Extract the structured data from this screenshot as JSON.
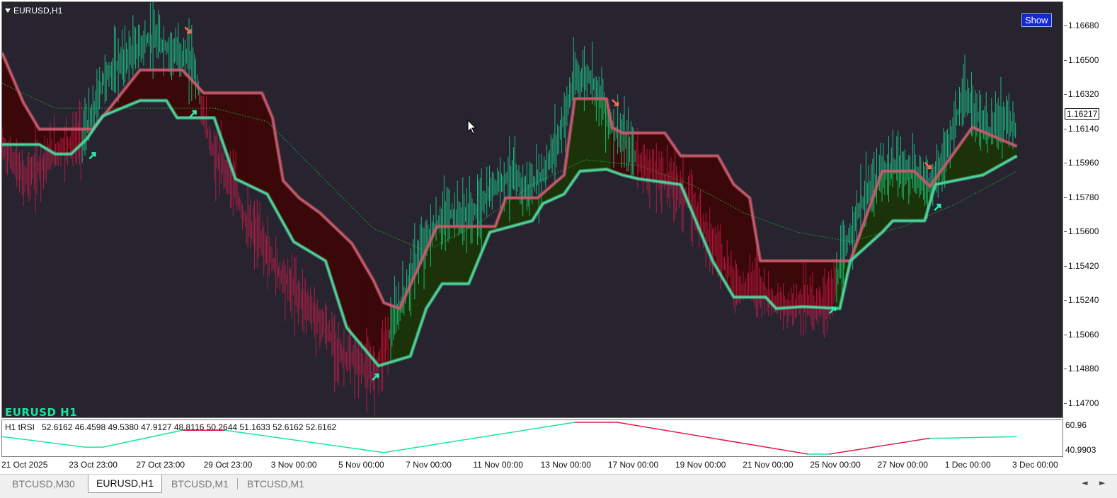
{
  "symbol": "EURUSD,H1",
  "show_button": "Show",
  "chart_label": "EURUSD H1",
  "current_price": "1.16217",
  "price_axis": [
    "1.16680",
    "1.16500",
    "1.16320",
    "1.16140",
    "1.15960",
    "1.15780",
    "1.15600",
    "1.15420",
    "1.15240",
    "1.15060",
    "1.14880",
    "1.14700"
  ],
  "indicator": {
    "label": "H1 tRSI",
    "values": "52.6162 46.4598 49.5380 47.9127 48.8116 50.2644 51.1633 52.6162 52.6162",
    "axis_top": "60.96",
    "axis_bottom": "40.9903"
  },
  "time_axis": [
    "21 Oct 2025",
    "23 Oct 23:00",
    "27 Oct 23:00",
    "29 Oct 23:00",
    "3 Nov 00:00",
    "5 Nov 00:00",
    "7 Nov 00:00",
    "11 Nov 00:00",
    "13 Nov 00:00",
    "17 Nov 00:00",
    "19 Nov 00:00",
    "21 Nov 00:00",
    "25 Nov 00:00",
    "27 Nov 00:00",
    "1 Dec 00:00",
    "3 Dec 00:00"
  ],
  "tabs": [
    "BTCUSD,M30",
    "EURUSD,H1",
    "BTCUSD,M1",
    "BTCUSD,M1"
  ],
  "active_tab": 1,
  "nav_left": "◄",
  "nav_right": "►",
  "colors": {
    "background": "#27242f",
    "bull": "#19e69a",
    "bear": "#d81c4c",
    "bull_fill": "#1c3309",
    "bear_fill": "#3a0808",
    "ma": "#1f9a3a"
  },
  "chart_data": {
    "type": "line",
    "y_range": [
      1.1462,
      1.1689
    ],
    "price": [
      {
        "t": 0,
        "p": 1.1605
      },
      {
        "t": 0.01,
        "p": 1.1598
      },
      {
        "t": 0.02,
        "p": 1.1588
      },
      {
        "t": 0.03,
        "p": 1.1592
      },
      {
        "t": 0.045,
        "p": 1.16
      },
      {
        "t": 0.06,
        "p": 1.1606
      },
      {
        "t": 0.075,
        "p": 1.161
      },
      {
        "t": 0.085,
        "p": 1.162
      },
      {
        "t": 0.095,
        "p": 1.164
      },
      {
        "t": 0.11,
        "p": 1.1648
      },
      {
        "t": 0.125,
        "p": 1.1655
      },
      {
        "t": 0.14,
        "p": 1.1662
      },
      {
        "t": 0.16,
        "p": 1.1655
      },
      {
        "t": 0.18,
        "p": 1.165
      },
      {
        "t": 0.19,
        "p": 1.162
      },
      {
        "t": 0.2,
        "p": 1.16
      },
      {
        "t": 0.215,
        "p": 1.159
      },
      {
        "t": 0.23,
        "p": 1.1565
      },
      {
        "t": 0.245,
        "p": 1.1555
      },
      {
        "t": 0.26,
        "p": 1.154
      },
      {
        "t": 0.275,
        "p": 1.153
      },
      {
        "t": 0.29,
        "p": 1.152
      },
      {
        "t": 0.305,
        "p": 1.151
      },
      {
        "t": 0.32,
        "p": 1.1495
      },
      {
        "t": 0.335,
        "p": 1.1492
      },
      {
        "t": 0.35,
        "p": 1.1485
      },
      {
        "t": 0.36,
        "p": 1.15
      },
      {
        "t": 0.375,
        "p": 1.152
      },
      {
        "t": 0.39,
        "p": 1.1545
      },
      {
        "t": 0.405,
        "p": 1.156
      },
      {
        "t": 0.42,
        "p": 1.157
      },
      {
        "t": 0.435,
        "p": 1.1568
      },
      {
        "t": 0.45,
        "p": 1.1572
      },
      {
        "t": 0.465,
        "p": 1.1585
      },
      {
        "t": 0.48,
        "p": 1.159
      },
      {
        "t": 0.495,
        "p": 1.1582
      },
      {
        "t": 0.51,
        "p": 1.159
      },
      {
        "t": 0.525,
        "p": 1.161
      },
      {
        "t": 0.54,
        "p": 1.164
      },
      {
        "t": 0.555,
        "p": 1.1642
      },
      {
        "t": 0.565,
        "p": 1.163
      },
      {
        "t": 0.575,
        "p": 1.1615
      },
      {
        "t": 0.59,
        "p": 1.1605
      },
      {
        "t": 0.605,
        "p": 1.1595
      },
      {
        "t": 0.62,
        "p": 1.159
      },
      {
        "t": 0.635,
        "p": 1.1585
      },
      {
        "t": 0.65,
        "p": 1.1575
      },
      {
        "t": 0.665,
        "p": 1.156
      },
      {
        "t": 0.68,
        "p": 1.1545
      },
      {
        "t": 0.695,
        "p": 1.153
      },
      {
        "t": 0.71,
        "p": 1.1535
      },
      {
        "t": 0.725,
        "p": 1.1525
      },
      {
        "t": 0.74,
        "p": 1.152
      },
      {
        "t": 0.755,
        "p": 1.1525
      },
      {
        "t": 0.77,
        "p": 1.152
      },
      {
        "t": 0.785,
        "p": 1.153
      },
      {
        "t": 0.8,
        "p": 1.156
      },
      {
        "t": 0.815,
        "p": 1.158
      },
      {
        "t": 0.83,
        "p": 1.159
      },
      {
        "t": 0.845,
        "p": 1.1595
      },
      {
        "t": 0.86,
        "p": 1.159
      },
      {
        "t": 0.875,
        "p": 1.1585
      },
      {
        "t": 0.89,
        "p": 1.16
      },
      {
        "t": 0.905,
        "p": 1.163
      },
      {
        "t": 0.915,
        "p": 1.1625
      },
      {
        "t": 0.93,
        "p": 1.1612
      },
      {
        "t": 0.945,
        "p": 1.162
      },
      {
        "t": 0.955,
        "p": 1.1615
      }
    ],
    "upper_band": [
      {
        "t": 0,
        "p": 1.1654
      },
      {
        "t": 0.02,
        "p": 1.1628
      },
      {
        "t": 0.035,
        "p": 1.1614
      },
      {
        "t": 0.085,
        "p": 1.1614
      },
      {
        "t": 0.1,
        "p": 1.1624
      },
      {
        "t": 0.13,
        "p": 1.1645
      },
      {
        "t": 0.17,
        "p": 1.1645
      },
      {
        "t": 0.19,
        "p": 1.1633
      },
      {
        "t": 0.245,
        "p": 1.1633
      },
      {
        "t": 0.255,
        "p": 1.162
      },
      {
        "t": 0.265,
        "p": 1.1587
      },
      {
        "t": 0.28,
        "p": 1.1578
      },
      {
        "t": 0.3,
        "p": 1.157
      },
      {
        "t": 0.33,
        "p": 1.1554
      },
      {
        "t": 0.35,
        "p": 1.1535
      },
      {
        "t": 0.36,
        "p": 1.1523
      },
      {
        "t": 0.375,
        "p": 1.152
      },
      {
        "t": 0.41,
        "p": 1.1563
      },
      {
        "t": 0.465,
        "p": 1.1563
      },
      {
        "t": 0.475,
        "p": 1.1578
      },
      {
        "t": 0.505,
        "p": 1.1578
      },
      {
        "t": 0.53,
        "p": 1.159
      },
      {
        "t": 0.54,
        "p": 1.163
      },
      {
        "t": 0.57,
        "p": 1.163
      },
      {
        "t": 0.575,
        "p": 1.1615
      },
      {
        "t": 0.585,
        "p": 1.1612
      },
      {
        "t": 0.625,
        "p": 1.1612
      },
      {
        "t": 0.64,
        "p": 1.16
      },
      {
        "t": 0.675,
        "p": 1.16
      },
      {
        "t": 0.69,
        "p": 1.1585
      },
      {
        "t": 0.705,
        "p": 1.1578
      },
      {
        "t": 0.715,
        "p": 1.1545
      },
      {
        "t": 0.78,
        "p": 1.1545
      },
      {
        "t": 0.79,
        "p": 1.1545
      },
      {
        "t": 0.8,
        "p": 1.1545
      },
      {
        "t": 0.83,
        "p": 1.1592
      },
      {
        "t": 0.86,
        "p": 1.1592
      },
      {
        "t": 0.875,
        "p": 1.1584
      },
      {
        "t": 0.915,
        "p": 1.1615
      },
      {
        "t": 0.957,
        "p": 1.1605
      }
    ],
    "lower_band": [
      {
        "t": 0,
        "p": 1.1606
      },
      {
        "t": 0.035,
        "p": 1.1606
      },
      {
        "t": 0.05,
        "p": 1.1601
      },
      {
        "t": 0.065,
        "p": 1.1601
      },
      {
        "t": 0.08,
        "p": 1.1609
      },
      {
        "t": 0.095,
        "p": 1.1621
      },
      {
        "t": 0.13,
        "p": 1.1629
      },
      {
        "t": 0.155,
        "p": 1.1629
      },
      {
        "t": 0.165,
        "p": 1.162
      },
      {
        "t": 0.2,
        "p": 1.162
      },
      {
        "t": 0.22,
        "p": 1.1588
      },
      {
        "t": 0.25,
        "p": 1.158
      },
      {
        "t": 0.275,
        "p": 1.1555
      },
      {
        "t": 0.305,
        "p": 1.1545
      },
      {
        "t": 0.325,
        "p": 1.151
      },
      {
        "t": 0.355,
        "p": 1.149
      },
      {
        "t": 0.385,
        "p": 1.1495
      },
      {
        "t": 0.4,
        "p": 1.152
      },
      {
        "t": 0.415,
        "p": 1.1533
      },
      {
        "t": 0.44,
        "p": 1.1533
      },
      {
        "t": 0.46,
        "p": 1.156
      },
      {
        "t": 0.5,
        "p": 1.1566
      },
      {
        "t": 0.51,
        "p": 1.1575
      },
      {
        "t": 0.53,
        "p": 1.158
      },
      {
        "t": 0.545,
        "p": 1.1592
      },
      {
        "t": 0.57,
        "p": 1.1593
      },
      {
        "t": 0.585,
        "p": 1.159
      },
      {
        "t": 0.6,
        "p": 1.1588
      },
      {
        "t": 0.64,
        "p": 1.1585
      },
      {
        "t": 0.67,
        "p": 1.1545
      },
      {
        "t": 0.69,
        "p": 1.1526
      },
      {
        "t": 0.72,
        "p": 1.1526
      },
      {
        "t": 0.73,
        "p": 1.152
      },
      {
        "t": 0.755,
        "p": 1.1521
      },
      {
        "t": 0.79,
        "p": 1.152
      },
      {
        "t": 0.8,
        "p": 1.1545
      },
      {
        "t": 0.83,
        "p": 1.156
      },
      {
        "t": 0.84,
        "p": 1.1566
      },
      {
        "t": 0.87,
        "p": 1.1566
      },
      {
        "t": 0.88,
        "p": 1.1585
      },
      {
        "t": 0.925,
        "p": 1.159
      },
      {
        "t": 0.957,
        "p": 1.16
      }
    ],
    "moving_average": [
      {
        "t": 0,
        "p": 1.1638
      },
      {
        "t": 0.05,
        "p": 1.1625
      },
      {
        "t": 0.1,
        "p": 1.1625
      },
      {
        "t": 0.15,
        "p": 1.1625
      },
      {
        "t": 0.2,
        "p": 1.1625
      },
      {
        "t": 0.25,
        "p": 1.1618
      },
      {
        "t": 0.3,
        "p": 1.159
      },
      {
        "t": 0.35,
        "p": 1.1562
      },
      {
        "t": 0.4,
        "p": 1.155
      },
      {
        "t": 0.45,
        "p": 1.1565
      },
      {
        "t": 0.5,
        "p": 1.1585
      },
      {
        "t": 0.55,
        "p": 1.1598
      },
      {
        "t": 0.6,
        "p": 1.1595
      },
      {
        "t": 0.65,
        "p": 1.1585
      },
      {
        "t": 0.7,
        "p": 1.157
      },
      {
        "t": 0.75,
        "p": 1.156
      },
      {
        "t": 0.8,
        "p": 1.1555
      },
      {
        "t": 0.85,
        "p": 1.1563
      },
      {
        "t": 0.9,
        "p": 1.1575
      },
      {
        "t": 0.957,
        "p": 1.1592
      }
    ],
    "signals": [
      {
        "t": 0.085,
        "p": 1.16,
        "dir": "up"
      },
      {
        "t": 0.175,
        "p": 1.1666,
        "dir": "down"
      },
      {
        "t": 0.18,
        "p": 1.1622,
        "dir": "up"
      },
      {
        "t": 0.352,
        "p": 1.1484,
        "dir": "up"
      },
      {
        "t": 0.578,
        "p": 1.1628,
        "dir": "down"
      },
      {
        "t": 0.783,
        "p": 1.1519,
        "dir": "up"
      },
      {
        "t": 0.873,
        "p": 1.1595,
        "dir": "down"
      },
      {
        "t": 0.882,
        "p": 1.1573,
        "dir": "up"
      }
    ],
    "oscillator": [
      {
        "t": 0,
        "v": 0.45,
        "c": "bear"
      },
      {
        "t": 0.078,
        "v": 0.78,
        "c": "bull"
      },
      {
        "t": 0.095,
        "v": 0.78,
        "c": "bull"
      },
      {
        "t": 0.17,
        "v": 0.25,
        "c": "bull"
      },
      {
        "t": 0.21,
        "v": 0.25,
        "c": "bear"
      },
      {
        "t": 0.36,
        "v": 0.95,
        "c": "bull"
      },
      {
        "t": 0.54,
        "v": 0.0,
        "c": "bull"
      },
      {
        "t": 0.58,
        "v": 0.0,
        "c": "bear"
      },
      {
        "t": 0.76,
        "v": 1.0,
        "c": "bear"
      },
      {
        "t": 0.78,
        "v": 1.0,
        "c": "bull"
      },
      {
        "t": 0.875,
        "v": 0.5,
        "c": "bear"
      },
      {
        "t": 0.885,
        "v": 0.5,
        "c": "bull"
      },
      {
        "t": 0.957,
        "v": 0.45,
        "c": "bull"
      }
    ]
  }
}
